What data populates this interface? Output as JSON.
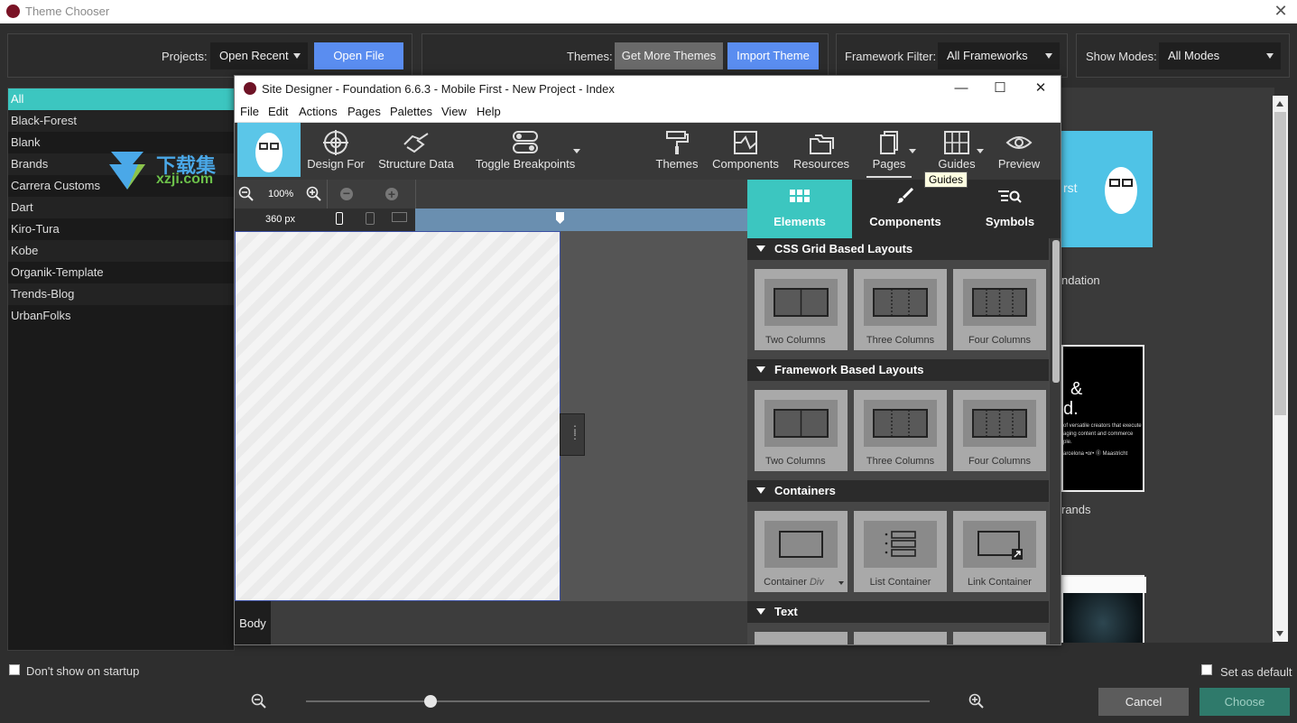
{
  "chooser": {
    "title": "Theme Chooser",
    "projects_label": "Projects:",
    "projects_value": "Open Recent",
    "open_file": "Open File",
    "themes_label": "Themes:",
    "get_more": "Get More Themes",
    "import_theme": "Import Theme",
    "framework_label": "Framework Filter:",
    "framework_value": "All Frameworks",
    "modes_label": "Show Modes:",
    "modes_value": "All Modes",
    "themes": [
      "All",
      "Black-Forest",
      "Blank",
      "Brands",
      "Carrera Customs",
      "Dart",
      "Kiro-Tura",
      "Kobe",
      "Organik-Template",
      "Trends-Blog",
      "UrbanFolks"
    ],
    "dont_show": "Don't show on startup",
    "set_default": "Set as default",
    "cancel": "Cancel",
    "choose": "Choose",
    "zoom_level": 0.2
  },
  "watermark": {
    "cn": "下载集",
    "url": "xzji.com"
  },
  "previews": {
    "p1_text": "rst",
    "p1_caption": "ndation",
    "p2_text_a": "&",
    "p2_text_b": "d.",
    "p2_small": "of versatile creators that execute",
    "p2_small2": "aging content and commerce",
    "p2_small3": "ple.",
    "p2_city": "arcelona •or• ⓪ Maastricht",
    "p2_caption": "rands"
  },
  "designer": {
    "title": "Site Designer - Foundation 6.6.3 - Mobile First - New Project - Index",
    "menu": [
      "File",
      "Edit",
      "Actions",
      "Pages",
      "Palettes",
      "View",
      "Help"
    ],
    "tools": {
      "design_for": "Design For",
      "structure_data": "Structure Data",
      "toggle_bp": "Toggle Breakpoints",
      "themes": "Themes",
      "components": "Components",
      "resources": "Resources",
      "pages": "Pages",
      "guides": "Guides",
      "preview": "Preview"
    },
    "tooltip": "Guides",
    "zoom": "100%",
    "width_px": "360 px",
    "body_tab": "Body",
    "panel_tabs": [
      "Elements",
      "Components",
      "Symbols"
    ],
    "sections": [
      {
        "title": "CSS Grid Based Layouts",
        "tiles": [
          "Two Columns",
          "Three Columns",
          "Four Columns"
        ]
      },
      {
        "title": "Framework Based Layouts",
        "tiles": [
          "Two Columns",
          "Three Columns",
          "Four Columns"
        ]
      },
      {
        "title": "Containers",
        "tiles": [
          "Container",
          "List Container",
          "Link Container"
        ],
        "tile0_sub": "Div"
      },
      {
        "title": "Text",
        "tiles": []
      }
    ]
  },
  "colors": {
    "accent_teal": "#3cc6c0",
    "button_blue": "#5a8df0",
    "brand": "#7a1325"
  }
}
